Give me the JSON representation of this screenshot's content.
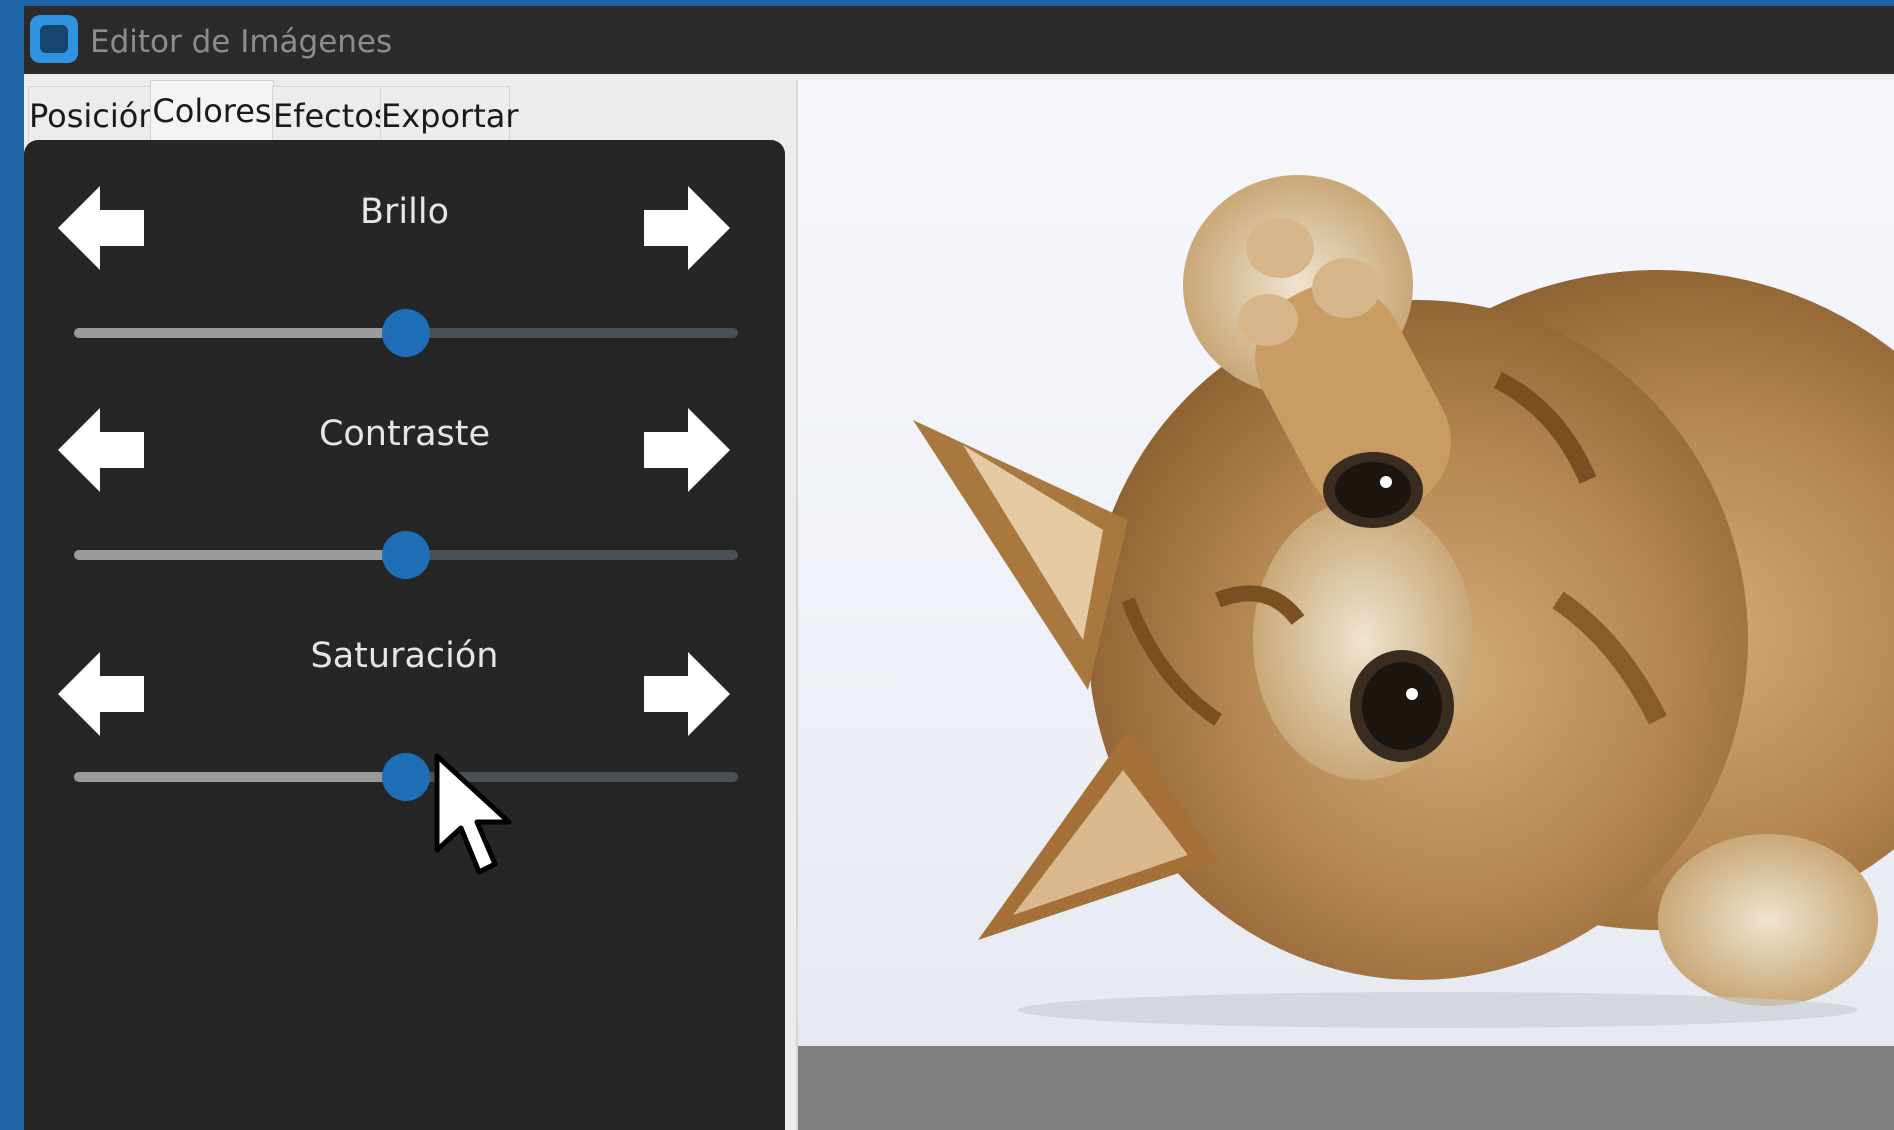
{
  "window": {
    "title": "Editor de Imágenes"
  },
  "tabs": [
    {
      "label": "Posición",
      "active": false
    },
    {
      "label": "Colores",
      "active": true
    },
    {
      "label": "Efectos",
      "active": false
    },
    {
      "label": "Exportar",
      "active": false
    }
  ],
  "controls": [
    {
      "label": "Brillo",
      "value_percent": 50
    },
    {
      "label": "Contraste",
      "value_percent": 50
    },
    {
      "label": "Saturación",
      "value_percent": 50
    }
  ],
  "icons": {
    "decrease": "arrow-left-icon",
    "increase": "arrow-right-icon",
    "app": "app-icon",
    "cursor": "mouse-pointer-icon"
  },
  "colors": {
    "accent": "#1f6fb8",
    "panel": "#262626",
    "titlebar": "#2b2b2b",
    "desktop": "#1f64a6"
  },
  "preview": {
    "subject": "kitten photo"
  }
}
